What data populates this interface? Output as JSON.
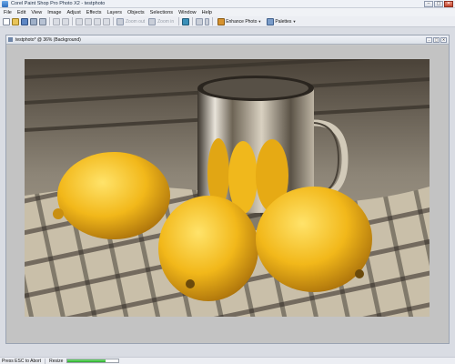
{
  "window": {
    "title": "Corel Paint Shop Pro Photo X2 - testphoto",
    "controls": {
      "minimize": "–",
      "maximize": "▢",
      "close": "✕"
    }
  },
  "menu": [
    "File",
    "Edit",
    "View",
    "Image",
    "Adjust",
    "Effects",
    "Layers",
    "Objects",
    "Selections",
    "Window",
    "Help"
  ],
  "toolbar": {
    "zoom_out_label": "Zoom out",
    "zoom_in_label": "Zoom in",
    "enhance_photo_label": "Enhance Photo",
    "palettes_label": "Palettes"
  },
  "document": {
    "title": "testphoto* @ 36% (Background)"
  },
  "status": {
    "hint": "Press ESC to Abort",
    "operation": "Resize",
    "progress": 0.75
  },
  "colors": {
    "accent": "#2e6dbb",
    "progress": "#27a827",
    "canvas_bg": "#c3c3c3"
  }
}
